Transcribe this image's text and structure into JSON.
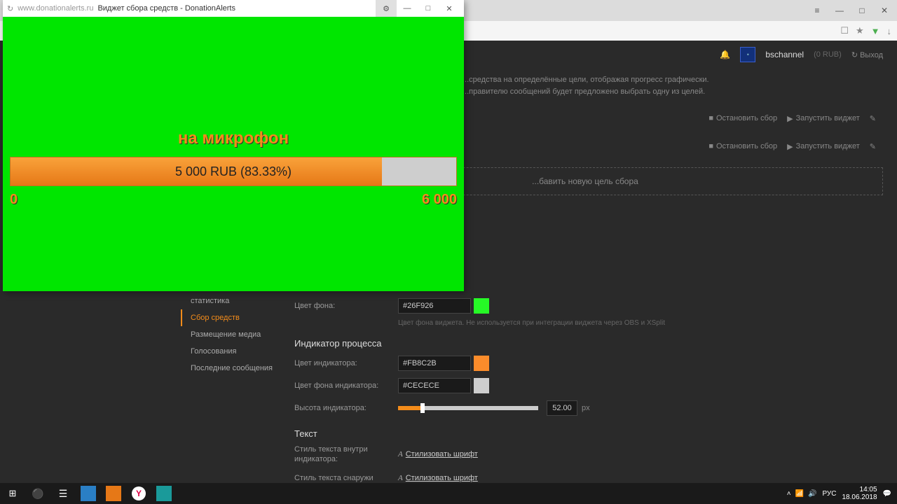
{
  "chrome": {
    "minimize": "—",
    "maximize": "□",
    "close": "✕",
    "menu": "≡"
  },
  "toolbar_icons": {
    "bookmarks": "☐",
    "star": "★",
    "shield": "▼",
    "download": "↓"
  },
  "dash": {
    "username": "bschannel",
    "balance": "(0 RUB)",
    "logout": "↻ Выход",
    "desc1": "...средства на определённые цели, отображая прогресс графически.",
    "desc2": "...правителю сообщений будет предложено выбрать одну из целей.",
    "stop": "Остановить сбор",
    "launch": "Запустить виджет",
    "add_goal": "...бавить новую цель сбора"
  },
  "sidebar": {
    "items": [
      "статистика",
      "Сбор средств",
      "Размещение медиа",
      "Голосования",
      "Последние сообщения"
    ],
    "active": 1
  },
  "settings": {
    "bg_label": "Цвет фона:",
    "bg_val": "#26F926",
    "bg_hint": "Цвет фона виджета. Не используется при интеграции виджета через OBS и XSplit",
    "indicator_title": "Индикатор процесса",
    "ind_color_label": "Цвет индикатора:",
    "ind_color_val": "#FB8C2B",
    "ind_bg_label": "Цвет фона индикатора:",
    "ind_bg_val": "#CECECE",
    "ind_h_label": "Высота индикатора:",
    "ind_h_val": "52.00",
    "px": "px",
    "text_title": "Текст",
    "text_in_label": "Стиль текста внутри индикатора:",
    "text_out_label": "Стиль текста снаружи",
    "style_link": "Стилизовать шрифт"
  },
  "popup": {
    "url": "www.donationalerts.ru",
    "title": "Виджет сбора средств - DonationAlerts",
    "min": "—",
    "max": "□",
    "close": "✕"
  },
  "widget": {
    "title": "на микрофон",
    "progress_text": "5 000 RUB (83.33%)",
    "min": "0",
    "max": "6 000",
    "fill_pct": 83.33
  },
  "taskbar": {
    "lang": "РУС",
    "time": "14:05",
    "date": "18.06.2018"
  }
}
